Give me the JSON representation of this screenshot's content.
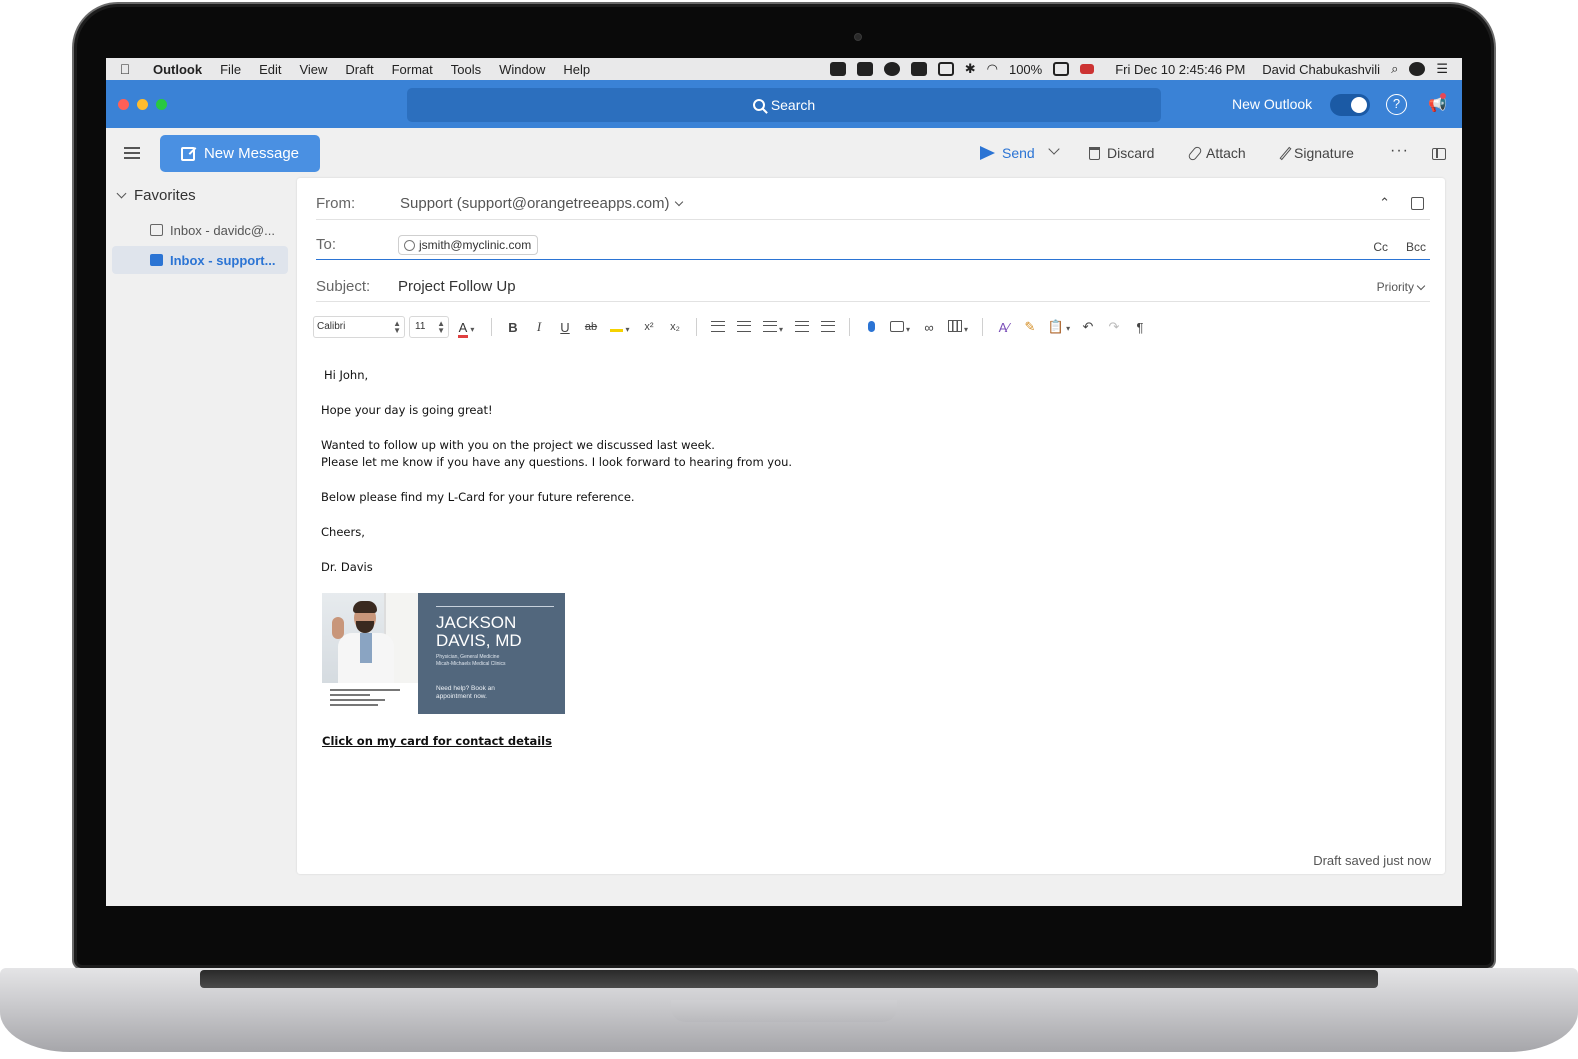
{
  "menubar": {
    "app": "Outlook",
    "items": [
      "File",
      "Edit",
      "View",
      "Draft",
      "Format",
      "Tools",
      "Window",
      "Help"
    ],
    "battery": "100%",
    "datetime": "Fri Dec 10  2:45:46 PM",
    "user": "David Chabukashvili"
  },
  "titlebar": {
    "search_label": "Search",
    "new_outlook_label": "New Outlook",
    "new_outlook_enabled": true,
    "help_glyph": "?"
  },
  "toolbar": {
    "new_message": "New Message",
    "send": "Send",
    "discard": "Discard",
    "attach": "Attach",
    "signature": "Signature",
    "more": "···"
  },
  "sidebar": {
    "favorites_label": "Favorites",
    "items": [
      {
        "label": "Inbox - davidc@...",
        "active": false
      },
      {
        "label": "Inbox - support...",
        "active": true
      }
    ]
  },
  "compose": {
    "from_label": "From:",
    "from_value": "Support (support@orangetreeapps.com)",
    "to_label": "To:",
    "to_recipient": "jsmith@myclinic.com",
    "cc_label": "Cc",
    "bcc_label": "Bcc",
    "subject_label": "Subject:",
    "subject_value": "Project Follow Up",
    "priority_label": "Priority",
    "font_name": "Calibri",
    "font_size": "11",
    "font_color_glyph": "A",
    "body_lines": [
      "Hi John,",
      "Hope your day is going great!",
      "Wanted to follow up with you on the project we discussed last week.",
      "Please let me know if you have any questions. I look forward to hearing from you.",
      "Below please find my L-Card for your future reference.",
      "Cheers,",
      "Dr. Davis"
    ],
    "card": {
      "name_line1": "JACKSON",
      "name_line2": "DAVIS, MD",
      "subtitle1": "Physician, General Medicine",
      "subtitle2": "Micah-Michaels Medical Clinics",
      "cta_line1": "Need help? Book an",
      "cta_line2": "appointment now."
    },
    "card_link": "Click on my card for contact details",
    "draft_status": "Draft saved just now"
  },
  "colors": {
    "titlebar": "#3a82d6",
    "accent": "#2b74d4",
    "card": "#52677d"
  }
}
